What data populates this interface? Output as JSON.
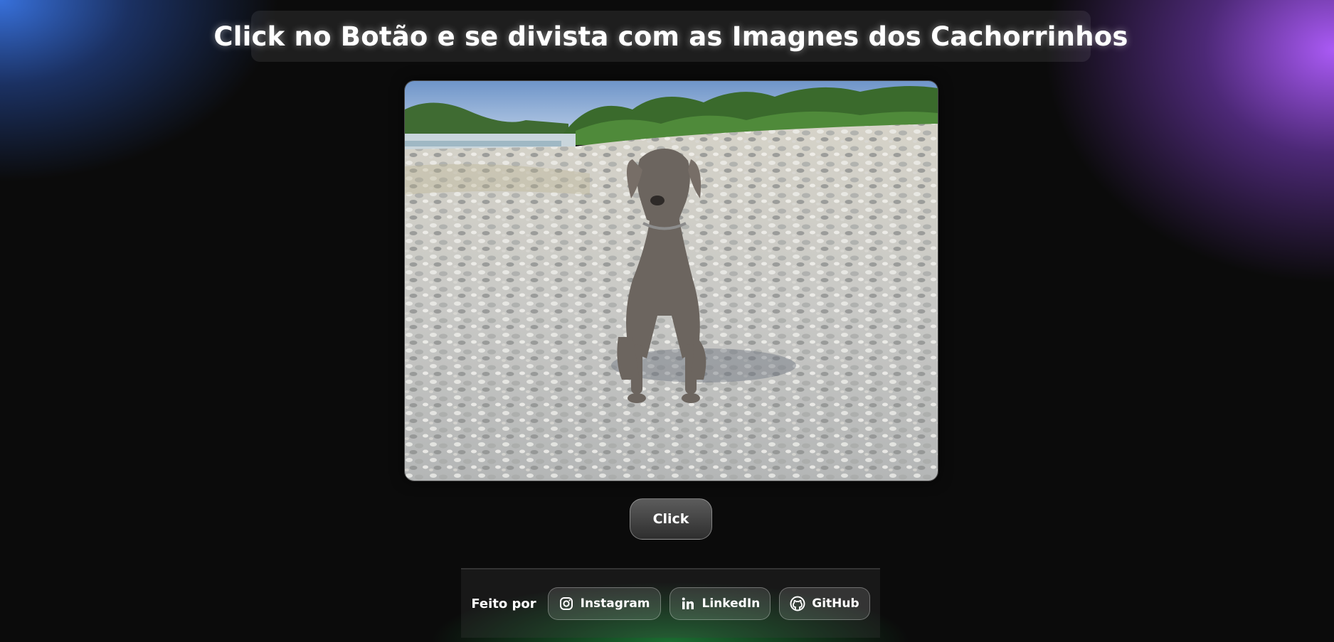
{
  "header": {
    "title": "Click no Botão e se divista com as Imagnes dos Cachorrinhos"
  },
  "main": {
    "image_alt": "Cachorro sentado em uma praia de pedras",
    "button_label": "Click"
  },
  "footer": {
    "label": "Feito por",
    "links": [
      {
        "label": "Instagram",
        "icon": "instagram-icon"
      },
      {
        "label": "LinkedIn",
        "icon": "linkedin-icon"
      },
      {
        "label": "GitHub",
        "icon": "github-icon"
      }
    ]
  },
  "colors": {
    "background": "#0b0b0b",
    "glow_blue": "#3a76e6",
    "glow_purple": "#aa5af5",
    "glow_green": "#28be50",
    "text": "#ffffff"
  }
}
